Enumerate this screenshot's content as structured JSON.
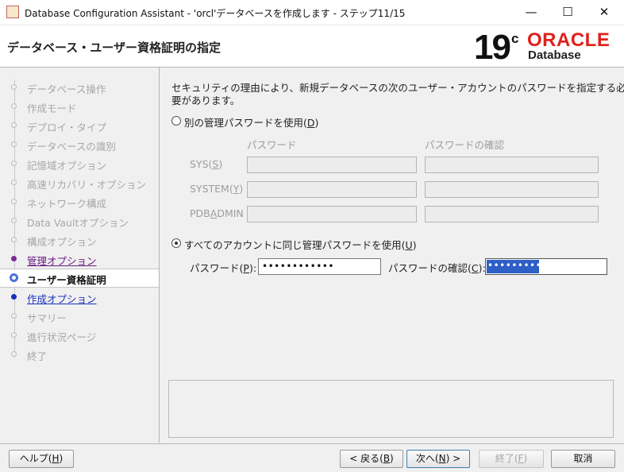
{
  "window": {
    "title": "Database Configuration Assistant - 'orcl'データベースを作成します - ステップ11/15",
    "minimize": "—",
    "maximize": "☐",
    "close": "✕"
  },
  "header": {
    "title": "データベース・ユーザー資格証明の指定",
    "logo_version": "19",
    "logo_c": "c",
    "logo_brand": "ORACLE",
    "logo_product": "Database"
  },
  "nav": {
    "items": [
      {
        "label": "データベース操作",
        "state": "done"
      },
      {
        "label": "作成モード",
        "state": "done"
      },
      {
        "label": "デプロイ・タイプ",
        "state": "done"
      },
      {
        "label": "データベースの識別",
        "state": "done"
      },
      {
        "label": "記憶域オプション",
        "state": "done"
      },
      {
        "label": "高速リカバリ・オプション",
        "state": "done"
      },
      {
        "label": "ネットワーク構成",
        "state": "done"
      },
      {
        "label": "Data Vaultオプション",
        "state": "done"
      },
      {
        "label": "構成オプション",
        "state": "done"
      },
      {
        "label": "管理オプション",
        "state": "visited"
      },
      {
        "label": "ユーザー資格証明",
        "state": "current"
      },
      {
        "label": "作成オプション",
        "state": "link"
      },
      {
        "label": "サマリー",
        "state": "future"
      },
      {
        "label": "進行状況ページ",
        "state": "future"
      },
      {
        "label": "終了",
        "state": "future"
      }
    ]
  },
  "content": {
    "description_line1": "セキュリティの理由により、新規データベースの次のユーザー・アカウントのパスワードを指定する必",
    "description_line2": "要があります。",
    "option_separate": {
      "label": "別の管理パスワードを使用",
      "mnemonic": "D",
      "selected": false
    },
    "col_password": "パスワード",
    "col_confirm": "パスワードの確認",
    "accounts": [
      {
        "name": "SYS",
        "mnemonic": "S"
      },
      {
        "name": "SYSTEM",
        "mnemonic": "Y"
      },
      {
        "name": "PDBADMIN",
        "mnemonic": "A"
      }
    ],
    "option_same": {
      "label": "すべてのアカウントに同じ管理パスワードを使用",
      "mnemonic": "U",
      "selected": true
    },
    "password_label": "パスワード",
    "password_mnemonic": "P",
    "password_value": "••••••••••••",
    "confirm_label": "パスワードの確認",
    "confirm_mnemonic": "C",
    "confirm_value": "••••••••••••"
  },
  "footer": {
    "help": {
      "label": "ヘルプ",
      "mnemonic": "H"
    },
    "back": {
      "label": "< 戻る",
      "mnemonic": "B"
    },
    "next": {
      "label": "次へ",
      "mnemonic": "N",
      "suffix": " >"
    },
    "finish": {
      "label": "終了",
      "mnemonic": "F"
    },
    "cancel": {
      "label": "取消"
    }
  }
}
